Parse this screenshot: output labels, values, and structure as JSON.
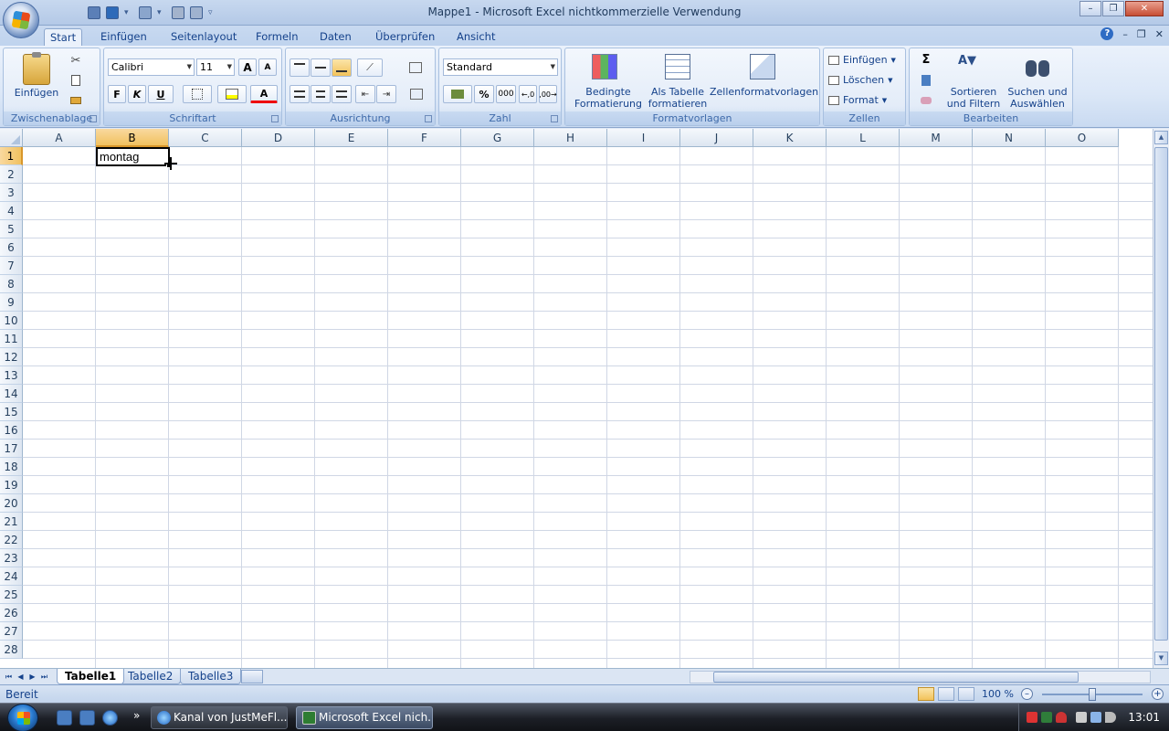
{
  "window": {
    "title": "Mappe1 - Microsoft Excel nichtkommerzielle Verwendung",
    "minimize": "–",
    "maximize": "❐",
    "close": "✕"
  },
  "ribbon_tabs": [
    "Start",
    "Einfügen",
    "Seitenlayout",
    "Formeln",
    "Daten",
    "Überprüfen",
    "Ansicht"
  ],
  "active_tab": "Start",
  "help": {
    "help_label": "?",
    "min": "–",
    "restore": "❐",
    "close": "✕"
  },
  "groups": {
    "clipboard": {
      "label": "Zwischenablage",
      "paste": "Einfügen"
    },
    "font": {
      "label": "Schriftart",
      "font_name": "Calibri",
      "font_size": "11",
      "bold": "F",
      "italic": "K",
      "underline": "U",
      "grow": "A",
      "shrink": "A",
      "font_color": "A"
    },
    "alignment": {
      "label": "Ausrichtung"
    },
    "number": {
      "label": "Zahl",
      "format": "Standard",
      "percent": "%",
      "thousands": "000"
    },
    "styles": {
      "label": "Formatvorlagen",
      "conditional_1": "Bedingte",
      "conditional_2": "Formatierung",
      "table_1": "Als Tabelle",
      "table_2": "formatieren",
      "cell_styles": "Zellenformatvorlagen"
    },
    "cells": {
      "label": "Zellen",
      "insert": "Einfügen",
      "delete": "Löschen",
      "format": "Format"
    },
    "editing": {
      "label": "Bearbeiten",
      "sum": "Σ",
      "sort_1": "Sortieren",
      "sort_2": "und Filtern",
      "find_1": "Suchen und",
      "find_2": "Auswählen"
    }
  },
  "columns": [
    "A",
    "B",
    "C",
    "D",
    "E",
    "F",
    "G",
    "H",
    "I",
    "J",
    "K",
    "L",
    "M",
    "N",
    "O"
  ],
  "rows": [
    "1",
    "2",
    "3",
    "4",
    "5",
    "6",
    "7",
    "8",
    "9",
    "10",
    "11",
    "12",
    "13",
    "14",
    "15",
    "16",
    "17",
    "18",
    "19",
    "20",
    "21",
    "22",
    "23",
    "24",
    "25",
    "26",
    "27",
    "28"
  ],
  "selected": {
    "column": "B",
    "row": "1"
  },
  "cells": {
    "B1": "montag"
  },
  "sheets": [
    "Tabelle1",
    "Tabelle2",
    "Tabelle3"
  ],
  "active_sheet": "Tabelle1",
  "status": {
    "text": "Bereit",
    "zoom": "100 %",
    "zoom_fraction": 0.5
  },
  "taskbar": {
    "buttons": [
      "Kanal von JustMeFl...",
      "Microsoft Excel nich..."
    ],
    "more": "»",
    "clock": "13:01"
  },
  "colors": {
    "accent": "#15428b",
    "selection": "#f1c15f",
    "ribbon_bg": "#dbe7f7",
    "grid_line": "#d0d7e5"
  }
}
